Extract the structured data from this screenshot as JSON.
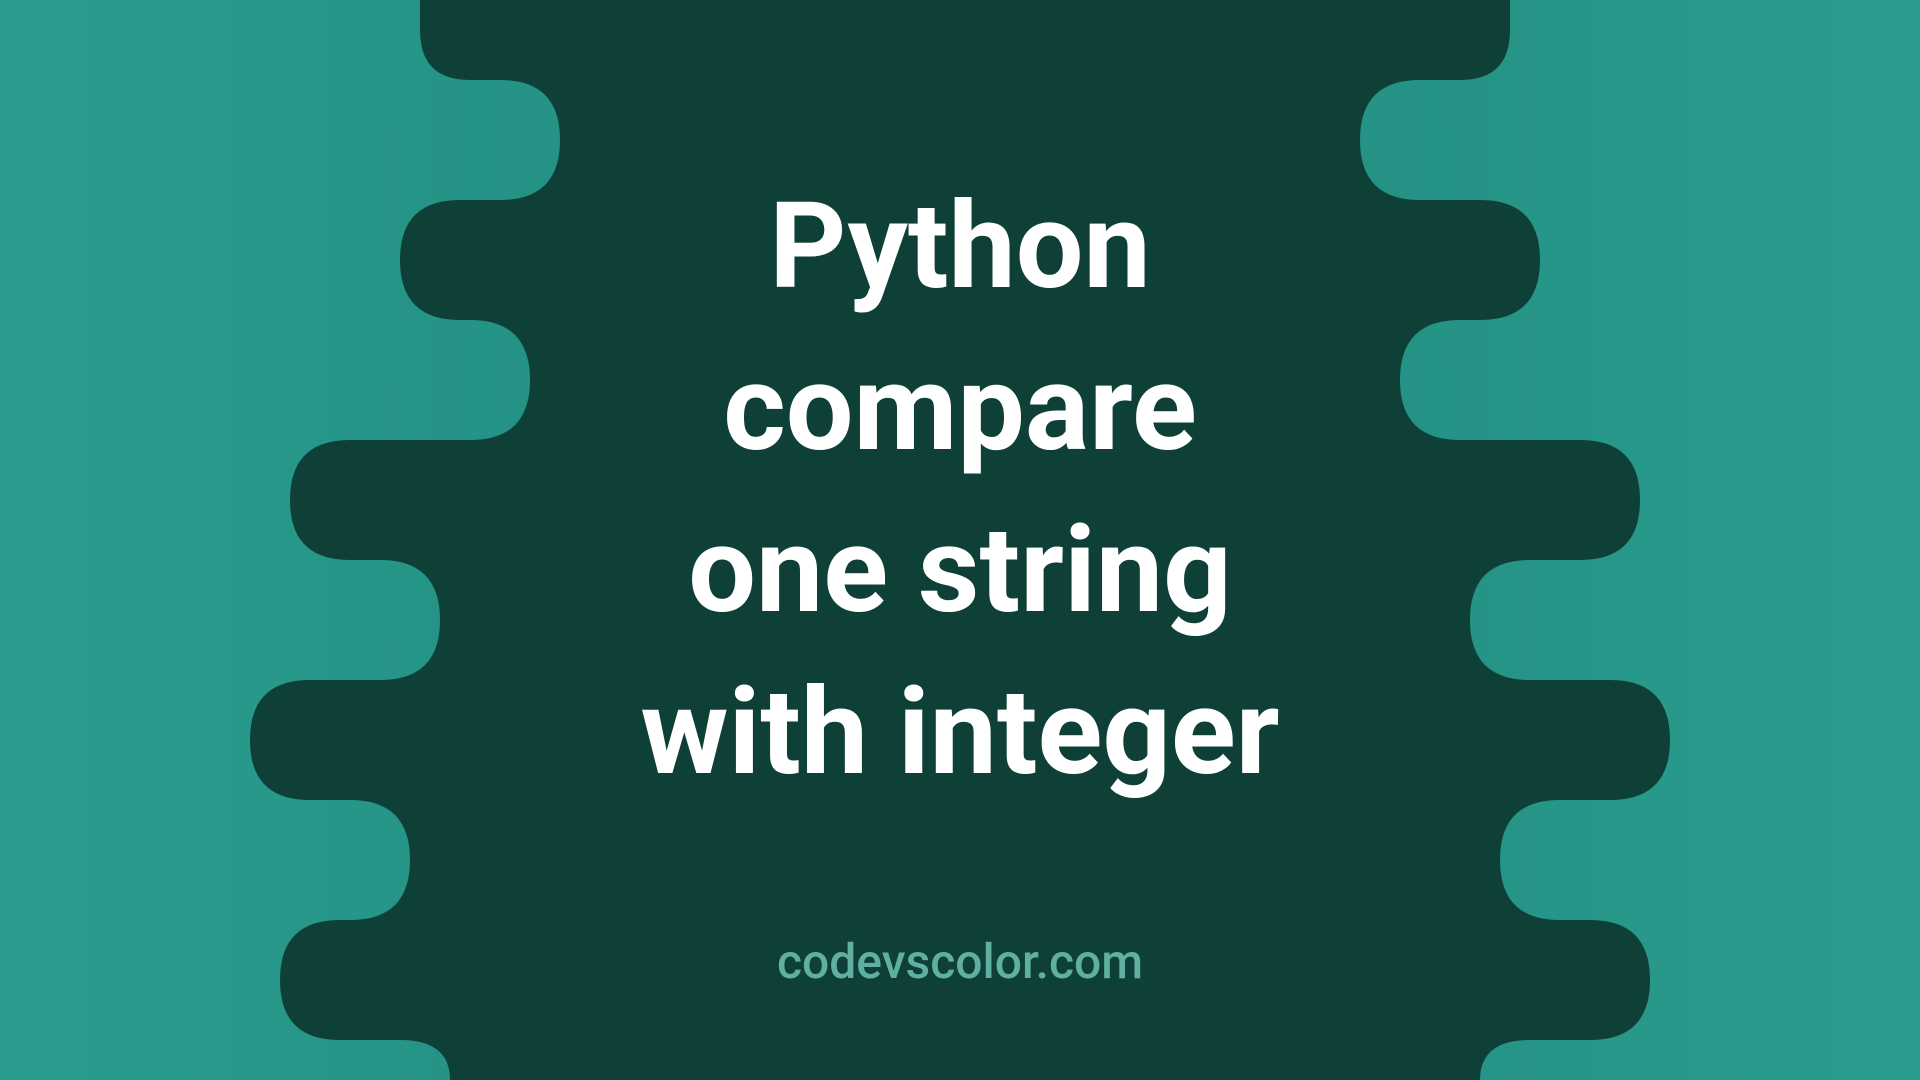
{
  "banner": {
    "title_line1": "Python",
    "title_line2": "compare",
    "title_line3": "one string",
    "title_line4": "with integer",
    "watermark": "codevscolor.com"
  },
  "colors": {
    "background_teal": "#2a9d8f",
    "blob_dark": "#0f4037",
    "text_white": "#ffffff",
    "watermark_teal": "#5fb0a3"
  }
}
